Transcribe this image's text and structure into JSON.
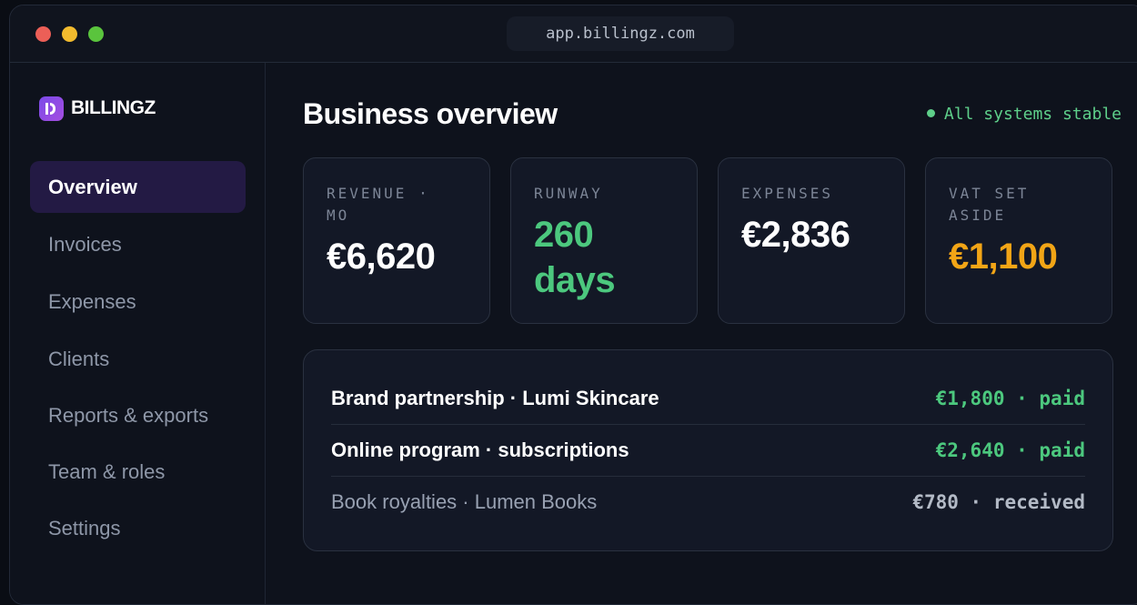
{
  "window": {
    "url": "app.billingz.com"
  },
  "brand": {
    "name": "BILLINGZ"
  },
  "sidebar": {
    "items": [
      {
        "label": "Overview",
        "active": true
      },
      {
        "label": "Invoices"
      },
      {
        "label": "Expenses"
      },
      {
        "label": "Clients"
      },
      {
        "label": "Reports & exports"
      },
      {
        "label": "Team & roles"
      },
      {
        "label": "Settings"
      }
    ]
  },
  "main": {
    "title": "Business overview",
    "status": "All systems stable",
    "cards": [
      {
        "label": "REVENUE · MO",
        "value": "€6,620",
        "color": "#ffffff"
      },
      {
        "label": "RUNWAY",
        "value": "260 days",
        "color": "#4cc87e"
      },
      {
        "label": "EXPENSES",
        "value": "€2,836",
        "color": "#ffffff"
      },
      {
        "label": "VAT SET ASIDE",
        "value": "€1,100",
        "color": "#f2a516"
      }
    ],
    "ledger": [
      {
        "label": "Brand partnership · Lumi Skincare",
        "amount": "€1,800 · paid"
      },
      {
        "label": "Online program · subscriptions",
        "amount": "€2,640 · paid"
      },
      {
        "label": "Book royalties · Lumen Books",
        "amount": "€780 · received"
      }
    ]
  },
  "colors": {
    "accent": "#7b4ae8",
    "success": "#4cc87e",
    "warning": "#f2a516",
    "background": "#0e121c"
  }
}
